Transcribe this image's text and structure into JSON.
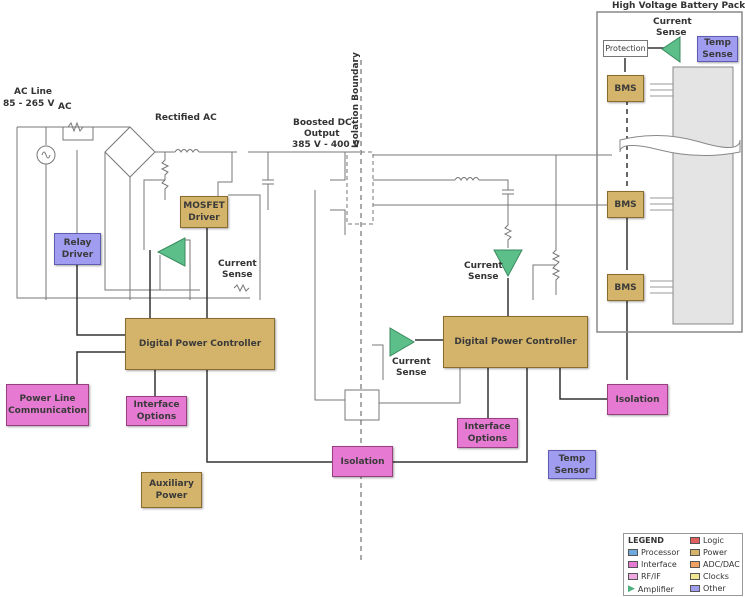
{
  "title": "High Voltage Battery Pack",
  "labels": {
    "ac_line": "AC Line",
    "ac_range": "85 - 265 V",
    "ac_sub": "AC",
    "rectified_ac": "Rectified AC",
    "boosted_dc_1": "Boosted DC",
    "boosted_dc_2": "Output",
    "boosted_dc_3": "385 V - 400 V",
    "isolation_boundary": "Isolation Boundary",
    "current_sense_1": "Current",
    "current_sense_2": "Sense"
  },
  "blocks": {
    "relay_driver": "Relay Driver",
    "mosfet_driver": "MOSFET Driver",
    "dpc_left": "Digital Power Controller",
    "dpc_right": "Digital Power Controller",
    "power_line_comm": "Power Line Communication",
    "interface_options_left": "Interface Options",
    "interface_options_right": "Interface Options",
    "auxiliary_power": "Auxiliary Power",
    "isolation_bottom": "Isolation",
    "isolation_right": "Isolation",
    "temp_sensor": "Temp Sensor",
    "protection": "Protection",
    "temp_sense": "Temp Sense",
    "bms_1": "BMS",
    "bms_2": "BMS",
    "bms_3": "BMS"
  },
  "legend": {
    "title": "LEGEND",
    "items": [
      {
        "label": "Processor",
        "color": "#6fa8dc"
      },
      {
        "label": "Interface",
        "color": "#e67ad3"
      },
      {
        "label": "RF/IF",
        "color": "#f0a8e0"
      },
      {
        "label": "Amplifier",
        "color": "#4caf7d"
      },
      {
        "label": "Logic",
        "color": "#e06060"
      },
      {
        "label": "Power",
        "color": "#d4b46a"
      },
      {
        "label": "ADC/DAC",
        "color": "#f0a060"
      },
      {
        "label": "Clocks",
        "color": "#f0e890"
      },
      {
        "label": "Other",
        "color": "#a09cf0"
      }
    ]
  },
  "colors": {
    "power": "#d4b46a",
    "interface": "#e67ad3",
    "other": "#a09cf0",
    "amplifier": "#5cbf8a"
  }
}
